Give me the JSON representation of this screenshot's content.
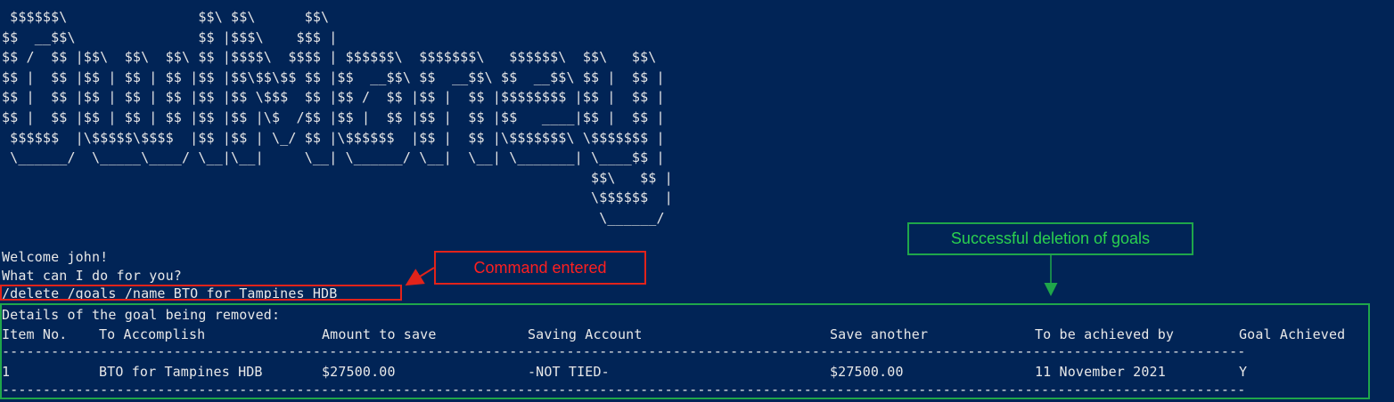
{
  "terminal": {
    "banner_art": " $$$$$$\\                $$\\ $$\\      $$\\\n$$  __$$\\               $$ |$$$\\    $$$ |\n$$ /  $$ |$$\\  $$\\  $$\\ $$ |$$$$\\  $$$$ | $$$$$$\\  $$$$$$$\\   $$$$$$\\  $$\\   $$\\\n$$ |  $$ |$$ | $$ | $$ |$$ |$$\\$$\\$$ $$ |$$  __$$\\ $$  __$$\\ $$  __$$\\ $$ |  $$ |\n$$ |  $$ |$$ | $$ | $$ |$$ |$$ \\$$$  $$ |$$ /  $$ |$$ |  $$ |$$$$$$$$ |$$ |  $$ |\n$$ |  $$ |$$ | $$ | $$ |$$ |$$ |\\$  /$$ |$$ |  $$ |$$ |  $$ |$$   ____|$$ |  $$ |\n $$$$$$  |\\$$$$$\\$$$$  |$$ |$$ | \\_/ $$ |\\$$$$$$  |$$ |  $$ |\\$$$$$$$\\ \\$$$$$$$ |\n \\______/  \\_____\\____/ \\__|\\__|     \\__| \\______/ \\__|  \\__| \\_______| \\____$$ |\n                                                                        $$\\   $$ |\n                                                                        \\$$$$$$  |\n                                                                         \\______/",
    "welcome": "Welcome john!",
    "prompt": "What can I do for you?",
    "command": "/delete /goals /name BTO for Tampines HDB",
    "details_heading": "Details of the goal being removed:",
    "table": {
      "headers": [
        "Item No.",
        "To Accomplish",
        "Amount to save",
        "Saving Account",
        "Save another",
        "To be achieved by",
        "Goal Achieved"
      ],
      "separator": "--------------------------------------------------------------------------------------------------------------------------------------------------------",
      "rows": [
        [
          "1",
          "BTO for Tampines HDB",
          "$27500.00",
          "-NOT TIED-",
          "$27500.00",
          "11 November 2021",
          "Y"
        ]
      ]
    }
  },
  "annotations": {
    "command_label": "Command entered",
    "success_label": "Successful deletion of goals",
    "red_color": "#e2231a",
    "green_color": "#1fa64a"
  },
  "colors": {
    "terminal_bg": "#012456",
    "terminal_fg": "#e8e8e8"
  }
}
